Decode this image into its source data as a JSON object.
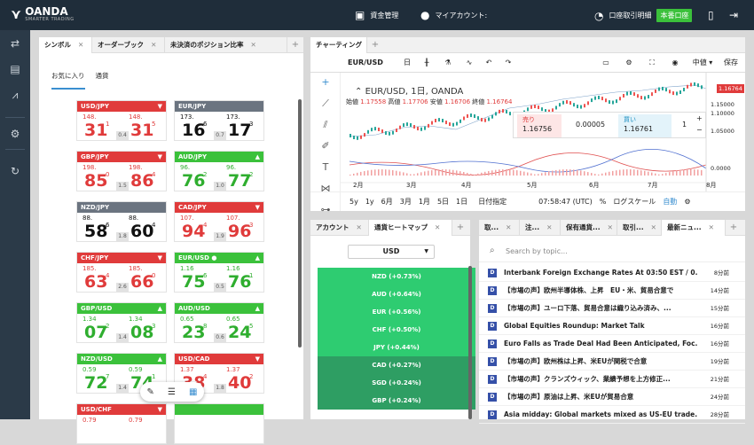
{
  "header": {
    "brand": "OANDA",
    "tagline": "SMARTER TRADING",
    "funds_label": "資金管理",
    "account_label": "マイアカウント:",
    "history_label": "口座取引明細",
    "live_badge": "本番口座"
  },
  "sidebar": {
    "icons": [
      "trade-icon",
      "newspaper-icon",
      "analysis-icon",
      "settings-icon",
      "refresh-icon"
    ]
  },
  "left_panel": {
    "tabs": [
      "シンボル",
      "オーダーブック",
      "未決済のポジション比率"
    ],
    "subtabs": [
      "お気に入り",
      "通貨"
    ],
    "tiles": [
      {
        "pair": "USD/JPY",
        "color": "red",
        "arrow": "▼",
        "bid_top": "148.",
        "bid_big": "31",
        "bid_sup": "1",
        "spread": "0.4",
        "ask_top": "148.",
        "ask_big": "31",
        "ask_sup": "5",
        "text": "red"
      },
      {
        "pair": "EUR/JPY",
        "color": "gray",
        "arrow": "",
        "bid_top": "173.",
        "bid_big": "16",
        "bid_sup": "6",
        "spread": "0.7",
        "ask_top": "173.",
        "ask_big": "17",
        "ask_sup": "3",
        "text": "black"
      },
      {
        "pair": "GBP/JPY",
        "color": "red",
        "arrow": "▼",
        "bid_top": "198.",
        "bid_big": "85",
        "bid_sup": "0",
        "spread": "1.5",
        "ask_top": "198.",
        "ask_big": "86",
        "ask_sup": "4",
        "text": "red"
      },
      {
        "pair": "AUD/JPY",
        "color": "green",
        "arrow": "▲",
        "bid_top": "96.",
        "bid_big": "76",
        "bid_sup": "2",
        "spread": "1.0",
        "ask_top": "96.",
        "ask_big": "77",
        "ask_sup": "2",
        "text": "green"
      },
      {
        "pair": "NZD/JPY",
        "color": "gray",
        "arrow": "",
        "bid_top": "88.",
        "bid_big": "58",
        "bid_sup": "6",
        "spread": "1.8",
        "ask_top": "88.",
        "ask_big": "60",
        "ask_sup": "4",
        "text": "black"
      },
      {
        "pair": "CAD/JPY",
        "color": "red",
        "arrow": "▼",
        "bid_top": "107.",
        "bid_big": "94",
        "bid_sup": "4",
        "spread": "1.9",
        "ask_top": "107.",
        "ask_big": "96",
        "ask_sup": "3",
        "text": "red"
      },
      {
        "pair": "CHF/JPY",
        "color": "red",
        "arrow": "▼",
        "bid_top": "185.",
        "bid_big": "63",
        "bid_sup": "4",
        "spread": "2.6",
        "ask_top": "185.",
        "ask_big": "66",
        "ask_sup": "0",
        "text": "red"
      },
      {
        "pair": "EUR/USD ●",
        "color": "green",
        "arrow": "▲",
        "bid_top": "1.16",
        "bid_big": "75",
        "bid_sup": "6",
        "spread": "0.5",
        "ask_top": "1.16",
        "ask_big": "76",
        "ask_sup": "1",
        "text": "green"
      },
      {
        "pair": "GBP/USD",
        "color": "green",
        "arrow": "▲",
        "bid_top": "1.34",
        "bid_big": "07",
        "bid_sup": "2",
        "spread": "1.4",
        "ask_top": "1.34",
        "ask_big": "08",
        "ask_sup": "3",
        "text": "green"
      },
      {
        "pair": "AUD/USD",
        "color": "green",
        "arrow": "▲",
        "bid_top": "0.65",
        "bid_big": "23",
        "bid_sup": "8",
        "spread": "0.6",
        "ask_top": "0.65",
        "ask_big": "24",
        "ask_sup": "5",
        "text": "green"
      },
      {
        "pair": "NZD/USD",
        "color": "green",
        "arrow": "▲",
        "bid_top": "0.59",
        "bid_big": "72",
        "bid_sup": "7",
        "spread": "1.4",
        "ask_top": "0.59",
        "ask_big": "74",
        "ask_sup": "1",
        "text": "green"
      },
      {
        "pair": "USD/CAD",
        "color": "red",
        "arrow": "▼",
        "bid_top": "1.37",
        "bid_big": "38",
        "bid_sup": "4",
        "spread": "1.8",
        "ask_top": "1.37",
        "ask_big": "40",
        "ask_sup": "2",
        "text": "red"
      },
      {
        "pair": "USD/CHF",
        "color": "red",
        "arrow": "▼",
        "bid_top": "0.79",
        "bid_big": "",
        "bid_sup": "",
        "spread": "",
        "ask_top": "0.79",
        "ask_big": "",
        "ask_sup": "",
        "text": "red"
      },
      {
        "pair": "",
        "color": "green",
        "arrow": "",
        "bid_top": "",
        "bid_big": "",
        "bid_sup": "",
        "spread": "",
        "ask_top": "",
        "ask_big": "",
        "ask_sup": "",
        "text": "green"
      }
    ]
  },
  "chart_panel": {
    "tab": "チャーティング",
    "symbol": "EUR/USD",
    "interval": "日",
    "price_mode": "中値",
    "save_label": "保存",
    "legend_title": "EUR/USD, 1日, OANDA",
    "ohlc": {
      "open_label": "始値",
      "open": "1.17558",
      "high_label": "高値",
      "high": "1.17706",
      "low_label": "安値",
      "low": "1.16706",
      "close_label": "終値",
      "close": "1.16764"
    },
    "sell_label": "売り",
    "sell_price": "1.16756",
    "spread_value": "0.00005",
    "buy_label": "買い",
    "buy_price": "1.16761",
    "qty": "1",
    "last_price": "1.16764",
    "price_axis": [
      "1.15000",
      "1.10000",
      "1.05000",
      "0.0000"
    ],
    "months": [
      "2月",
      "3月",
      "4月",
      "5月",
      "6月",
      "7月",
      "8月"
    ],
    "ranges": [
      "5y",
      "1y",
      "6月",
      "3月",
      "1月",
      "5日",
      "1日"
    ],
    "date_label": "日付指定",
    "clock": "07:58:47 (UTC)",
    "percent": "%",
    "log_label": "ログスケール",
    "auto_label": "自動"
  },
  "heatmap_panel": {
    "tabs": [
      "アカウント",
      "通貨ヒートマップ"
    ],
    "currency": "USD",
    "rows": [
      {
        "label": "NZD (+0.73%)",
        "color": "#2ecc71"
      },
      {
        "label": "AUD (+0.64%)",
        "color": "#2ecc71"
      },
      {
        "label": "EUR (+0.56%)",
        "color": "#2ecc71"
      },
      {
        "label": "CHF (+0.50%)",
        "color": "#2ecc71"
      },
      {
        "label": "JPY (+0.44%)",
        "color": "#2ecc71"
      },
      {
        "label": "CAD (+0.27%)",
        "color": "#2e9e63"
      },
      {
        "label": "SGD (+0.24%)",
        "color": "#2e9e63"
      },
      {
        "label": "GBP (+0.24%)",
        "color": "#2e9e63"
      }
    ]
  },
  "news_panel": {
    "tabs": [
      "取...",
      "注...",
      "保有通貨...",
      "取引...",
      "最新ニュ..."
    ],
    "search_placeholder": "Search by topic...",
    "items": [
      {
        "title": "Interbank Foreign Exchange Rates At 03:50 EST / 0...",
        "time": "8分前"
      },
      {
        "title": "【市場の声】欧州半導体株、上昇　EU・米、貿易合意で",
        "time": "14分前"
      },
      {
        "title": "【市場の声】ユーロ下落、貿易合意は織り込み済み、...",
        "time": "15分前"
      },
      {
        "title": "Global Equities Roundup: Market Talk",
        "time": "16分前"
      },
      {
        "title": "Euro Falls as Trade Deal Had Been Anticipated, Foc...",
        "time": "16分前"
      },
      {
        "title": "【市場の声】欧州株は上昇、米EUが関税で合意",
        "time": "19分前"
      },
      {
        "title": "【市場の声】クランズウィック、業績予想を上方修正...",
        "time": "21分前"
      },
      {
        "title": "【市場の声】原油は上昇、米EUが貿易合意",
        "time": "24分前"
      },
      {
        "title": "Asia midday: Global markets mixed as US-EU trade...",
        "time": "28分前"
      }
    ]
  }
}
